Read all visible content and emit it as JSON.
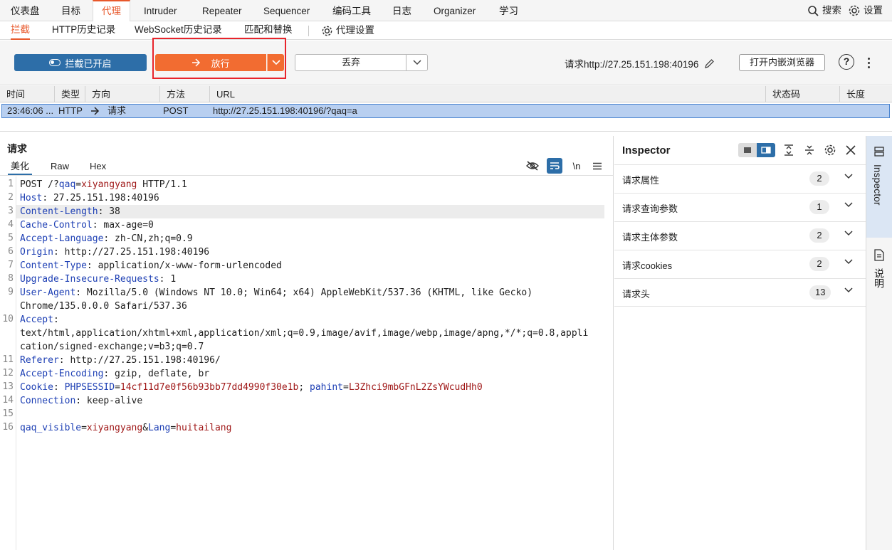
{
  "menu": {
    "items": [
      "仪表盘",
      "目标",
      "代理",
      "Intruder",
      "Repeater",
      "Sequencer",
      "编码工具",
      "日志",
      "Organizer",
      "学习"
    ],
    "active_index": 2,
    "search_label": "搜索",
    "settings_label": "设置"
  },
  "subtabs": {
    "items": [
      "拦截",
      "HTTP历史记录",
      "WebSocket历史记录",
      "匹配和替换"
    ],
    "proxy_settings_label": "代理设置",
    "active_index": 0
  },
  "toolbar": {
    "intercept_label": "拦截已开启",
    "forward_label": "放行",
    "drop_label": "丢弃",
    "request_target": "请求http://27.25.151.198:40196",
    "open_browser_label": "打开内嵌浏览器",
    "help_glyph": "?"
  },
  "history": {
    "columns": [
      "时间",
      "类型",
      "方向",
      "方法",
      "URL",
      "状态码",
      "长度"
    ],
    "rows": [
      {
        "time": "23:46:06 ...",
        "type": "HTTP",
        "direction": "请求",
        "method": "POST",
        "url": "http://27.25.151.198:40196/?qaq=a",
        "status": "",
        "length": ""
      }
    ]
  },
  "request": {
    "title": "请求",
    "tabs": [
      "美化",
      "Raw",
      "Hex"
    ],
    "active_tab": 0,
    "newline_label": "\\n",
    "lines": [
      {
        "n": "1",
        "parts": [
          [
            "t",
            "POST /?"
          ],
          [
            "k",
            "qaq"
          ],
          [
            "t",
            "="
          ],
          [
            "v",
            "xiyangyang"
          ],
          [
            "t",
            " HTTP/1.1"
          ]
        ]
      },
      {
        "n": "2",
        "parts": [
          [
            "k",
            "Host"
          ],
          [
            "t",
            ": 27.25.151.198:40196"
          ]
        ]
      },
      {
        "n": "3",
        "parts": [
          [
            "k",
            "Content-Length"
          ],
          [
            "t",
            ": 38"
          ]
        ],
        "highlight": true
      },
      {
        "n": "4",
        "parts": [
          [
            "k",
            "Cache-Control"
          ],
          [
            "t",
            ": max-age=0"
          ]
        ]
      },
      {
        "n": "5",
        "parts": [
          [
            "k",
            "Accept-Language"
          ],
          [
            "t",
            ": zh-CN,zh;q=0.9"
          ]
        ]
      },
      {
        "n": "6",
        "parts": [
          [
            "k",
            "Origin"
          ],
          [
            "t",
            ": http://27.25.151.198:40196"
          ]
        ]
      },
      {
        "n": "7",
        "parts": [
          [
            "k",
            "Content-Type"
          ],
          [
            "t",
            ": application/x-www-form-urlencoded"
          ]
        ]
      },
      {
        "n": "8",
        "parts": [
          [
            "k",
            "Upgrade-Insecure-Requests"
          ],
          [
            "t",
            ": 1"
          ]
        ]
      },
      {
        "n": "9",
        "parts": [
          [
            "k",
            "User-Agent"
          ],
          [
            "t",
            ": Mozilla/5.0 (Windows NT 10.0; Win64; x64) AppleWebKit/537.36 (KHTML, like Gecko)"
          ]
        ]
      },
      {
        "n": "",
        "parts": [
          [
            "t",
            "Chrome/135.0.0.0 Safari/537.36"
          ]
        ]
      },
      {
        "n": "10",
        "parts": [
          [
            "k",
            "Accept"
          ],
          [
            "t",
            ":"
          ]
        ]
      },
      {
        "n": "",
        "parts": [
          [
            "t",
            "text/html,application/xhtml+xml,application/xml;q=0.9,image/avif,image/webp,image/apng,*/*;q=0.8,appli"
          ]
        ]
      },
      {
        "n": "",
        "parts": [
          [
            "t",
            "cation/signed-exchange;v=b3;q=0.7"
          ]
        ]
      },
      {
        "n": "11",
        "parts": [
          [
            "k",
            "Referer"
          ],
          [
            "t",
            ": http://27.25.151.198:40196/"
          ]
        ]
      },
      {
        "n": "12",
        "parts": [
          [
            "k",
            "Accept-Encoding"
          ],
          [
            "t",
            ": gzip, deflate, br"
          ]
        ]
      },
      {
        "n": "13",
        "parts": [
          [
            "k",
            "Cookie"
          ],
          [
            "t",
            ": "
          ],
          [
            "k",
            "PHPSESSID"
          ],
          [
            "t",
            "="
          ],
          [
            "v",
            "14cf11d7e0f56b93bb77dd4990f30e1b"
          ],
          [
            "t",
            "; "
          ],
          [
            "k",
            "pahint"
          ],
          [
            "t",
            "="
          ],
          [
            "v",
            "L3Zhci9mbGFnL2ZsYWcudHh0"
          ]
        ]
      },
      {
        "n": "14",
        "parts": [
          [
            "k",
            "Connection"
          ],
          [
            "t",
            ": keep-alive"
          ]
        ]
      },
      {
        "n": "15",
        "parts": []
      },
      {
        "n": "16",
        "parts": [
          [
            "k",
            "qaq_visible"
          ],
          [
            "t",
            "="
          ],
          [
            "v",
            "xiyangyang"
          ],
          [
            "t",
            "&"
          ],
          [
            "k",
            "Lang"
          ],
          [
            "t",
            "="
          ],
          [
            "v",
            "huitailang"
          ]
        ]
      }
    ]
  },
  "inspector": {
    "title": "Inspector",
    "sections": [
      {
        "name": "请求属性",
        "count": "2"
      },
      {
        "name": "请求查询参数",
        "count": "1"
      },
      {
        "name": "请求主体参数",
        "count": "2"
      },
      {
        "name": "请求cookies",
        "count": "2"
      },
      {
        "name": "请求头",
        "count": "13"
      }
    ]
  },
  "rail": {
    "inspector_label": "Inspector",
    "notes_label": "说明"
  },
  "colors": {
    "accent": "#e8582b",
    "forward_button": "#f26c31",
    "intercept_button": "#2d6ea8",
    "selected_row": "#b8cff0",
    "highlight_box": "#e8242b",
    "header_name": "#1d3fb4",
    "param_value": "#a01919"
  }
}
